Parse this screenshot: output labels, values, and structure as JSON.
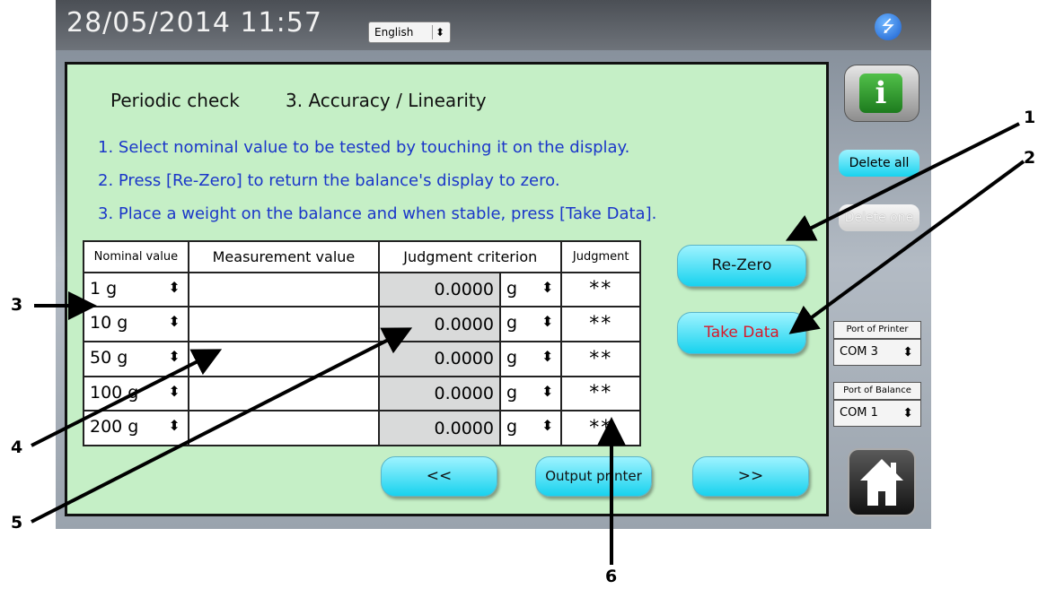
{
  "header": {
    "datetime": "28/05/2014  11:57",
    "language": "English",
    "arrow": "⬍",
    "usb_icon": "usb-icon"
  },
  "panel": {
    "title": "Periodic check",
    "subtitle": "3. Accuracy / Linearity",
    "steps": [
      "1. Select nominal value to be tested by touching it on the display.",
      "2. Press [Re-Zero] to return the balance's display to zero.",
      "3. Place a weight on the balance and when stable, press [Take Data]."
    ]
  },
  "table": {
    "headers": [
      "Nominal value",
      "Measurement value",
      "Judgment criterion",
      "Judgment"
    ],
    "rows": [
      {
        "nominal": "1 g",
        "measurement": "",
        "criterion": "0.0000",
        "unit": "g",
        "judgment": "**"
      },
      {
        "nominal": "10 g",
        "measurement": "",
        "criterion": "0.0000",
        "unit": "g",
        "judgment": "**"
      },
      {
        "nominal": "50 g",
        "measurement": "",
        "criterion": "0.0000",
        "unit": "g",
        "judgment": "**"
      },
      {
        "nominal": "100 g",
        "measurement": "",
        "criterion": "0.0000",
        "unit": "g",
        "judgment": "**"
      },
      {
        "nominal": "200 g",
        "measurement": "",
        "criterion": "0.0000",
        "unit": "g",
        "judgment": "**"
      }
    ]
  },
  "buttons": {
    "rezero": "Re-Zero",
    "take_data": "Take Data",
    "prev": "<<",
    "output_printer": "Output printer",
    "next": ">>",
    "delete_all": "Delete all",
    "delete_one": "Delete one"
  },
  "sidebar": {
    "info_icon": "i",
    "port_printer_label": "Port of Printer",
    "port_printer_value": "COM 3",
    "port_balance_label": "Port of Balance",
    "port_balance_value": "COM 1"
  },
  "callouts": [
    "1",
    "2",
    "3",
    "4",
    "5",
    "6"
  ],
  "colors": {
    "panel_bg": "#c5efc6",
    "button": "#18d2ee",
    "step_text": "#1a36c9",
    "take_data_text": "#d8192a"
  }
}
